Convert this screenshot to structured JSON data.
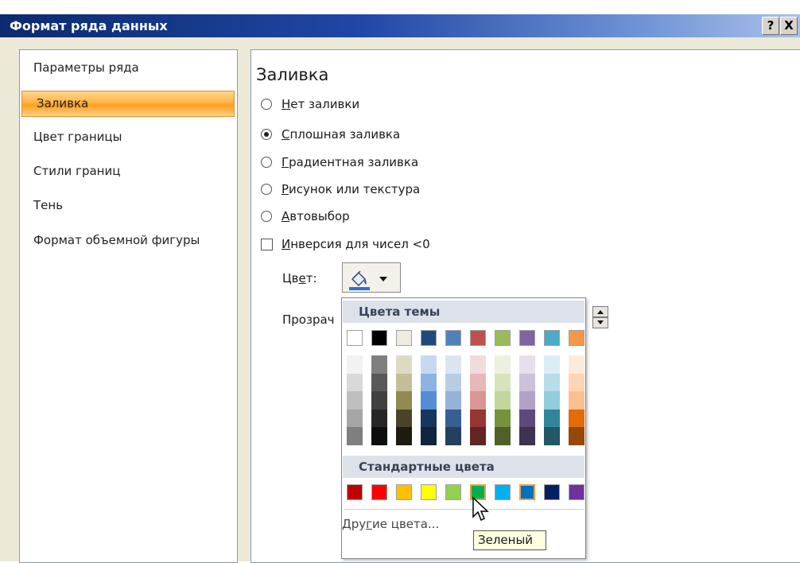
{
  "window": {
    "title": "Формат ряда данных",
    "help_label": "?",
    "close_label": "X"
  },
  "nav": {
    "items": [
      {
        "label": "Параметры ряда",
        "selected": false
      },
      {
        "label": "Заливка",
        "selected": true
      },
      {
        "label": "Цвет границы",
        "selected": false
      },
      {
        "label": "Стили границ",
        "selected": false
      },
      {
        "label": "Тень",
        "selected": false
      },
      {
        "label": "Формат объемной фигуры",
        "selected": false
      }
    ]
  },
  "fill": {
    "section_title": "Заливка",
    "options": [
      {
        "label_u": "Н",
        "label_rest": "ет заливки",
        "selected": false
      },
      {
        "label_u": "С",
        "label_rest": "плошная заливка",
        "selected": true
      },
      {
        "label_u": "Г",
        "label_rest": "радиентная заливка",
        "selected": false
      },
      {
        "label_u": "Р",
        "label_rest": "исунок или текстура",
        "selected": false
      },
      {
        "label_u": "А",
        "label_rest": "втовыбор",
        "selected": false
      }
    ],
    "invert": {
      "label_u": "И",
      "label_rest": "нверсия для чисел <0",
      "checked": false
    },
    "color_label_a": "Цв",
    "color_label_u": "е",
    "color_label_b": "т:",
    "transparency_label": "Прозрач"
  },
  "palette": {
    "theme_header": "Цвета темы",
    "standard_header": "Стандартные цвета",
    "more_a": "Дру",
    "more_u": "г",
    "more_b": "ие цвета...",
    "theme_top": [
      "#ffffff",
      "#000000",
      "#eeece1",
      "#1f497d",
      "#4f81bd",
      "#c0504d",
      "#9bbb59",
      "#8064a2",
      "#4bacc6",
      "#f79646"
    ],
    "theme_shades": [
      [
        "#f2f2f2",
        "#d9d9d9",
        "#bfbfbf",
        "#a6a6a6",
        "#7f7f7f"
      ],
      [
        "#7f7f7f",
        "#595959",
        "#404040",
        "#262626",
        "#0d0d0d"
      ],
      [
        "#ddd9c3",
        "#c4bd97",
        "#938953",
        "#494429",
        "#1d1b10"
      ],
      [
        "#c6d9f0",
        "#8db3e2",
        "#548dd4",
        "#17365d",
        "#0f243e"
      ],
      [
        "#dbe5f1",
        "#b8cce4",
        "#95b3d7",
        "#366092",
        "#244061"
      ],
      [
        "#f2dcdb",
        "#e5b9b7",
        "#d99694",
        "#953734",
        "#632423"
      ],
      [
        "#ebf1dd",
        "#d7e3bc",
        "#c3d69b",
        "#76923c",
        "#4f6128"
      ],
      [
        "#e5e0ec",
        "#ccc1d9",
        "#b2a2c7",
        "#5f497a",
        "#3f3151"
      ],
      [
        "#dbeef3",
        "#b7dde8",
        "#92cddc",
        "#31859b",
        "#205867"
      ],
      [
        "#fdeada",
        "#fbd5b5",
        "#fac08f",
        "#e36c09",
        "#974806"
      ]
    ],
    "standard": [
      "#c00000",
      "#ff0000",
      "#ffc000",
      "#ffff00",
      "#92d050",
      "#00b050",
      "#00b0f0",
      "#0070c0",
      "#002060",
      "#7030a0"
    ]
  },
  "tooltip": {
    "text": "Зеленый"
  }
}
